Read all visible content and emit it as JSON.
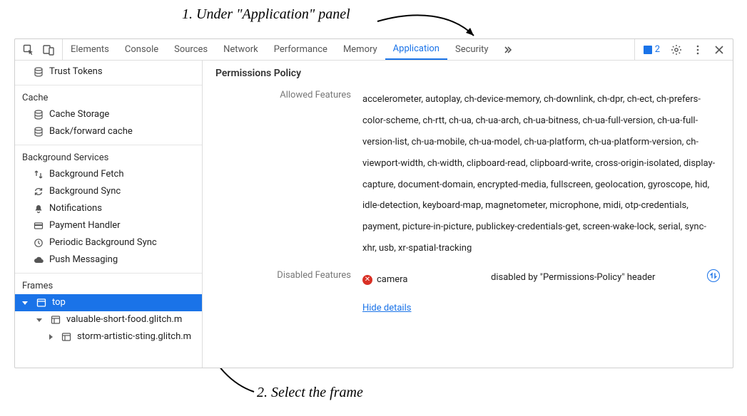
{
  "annotations": {
    "step1": "1. Under \"Application\" panel",
    "step2": "2. Select the frame"
  },
  "toolbar": {
    "tabs": {
      "elements": "Elements",
      "console": "Console",
      "sources": "Sources",
      "network": "Network",
      "performance": "Performance",
      "memory": "Memory",
      "application": "Application",
      "security": "Security"
    },
    "issues_count": "2"
  },
  "sidebar": {
    "trust_tokens": "Trust Tokens",
    "cache": {
      "title": "Cache",
      "cache_storage": "Cache Storage",
      "bf_cache": "Back/forward cache"
    },
    "bg": {
      "title": "Background Services",
      "bg_fetch": "Background Fetch",
      "bg_sync": "Background Sync",
      "notifications": "Notifications",
      "payment_handler": "Payment Handler",
      "periodic_bg_sync": "Periodic Background Sync",
      "push_messaging": "Push Messaging"
    },
    "frames": {
      "title": "Frames",
      "root": "top",
      "child1": "valuable-short-food.glitch.m",
      "child2": "storm-artistic-sting.glitch.m"
    }
  },
  "policy": {
    "heading": "Permissions Policy",
    "allowed_label": "Allowed Features",
    "allowed_value": "accelerometer, autoplay, ch-device-memory, ch-downlink, ch-dpr, ch-ect, ch-prefers-color-scheme, ch-rtt, ch-ua, ch-ua-arch, ch-ua-bitness, ch-ua-full-version, ch-ua-full-version-list, ch-ua-mobile, ch-ua-model, ch-ua-platform, ch-ua-platform-version, ch-viewport-width, ch-width, clipboard-read, clipboard-write, cross-origin-isolated, display-capture, document-domain, encrypted-media, fullscreen, geolocation, gyroscope, hid, idle-detection, keyboard-map, magnetometer, microphone, midi, otp-credentials, payment, picture-in-picture, publickey-credentials-get, screen-wake-lock, serial, sync-xhr, usb, xr-spatial-tracking",
    "disabled_label": "Disabled Features",
    "disabled_feature": "camera",
    "disabled_reason": "disabled by \"Permissions-Policy\" header",
    "hide_details": "Hide details"
  }
}
